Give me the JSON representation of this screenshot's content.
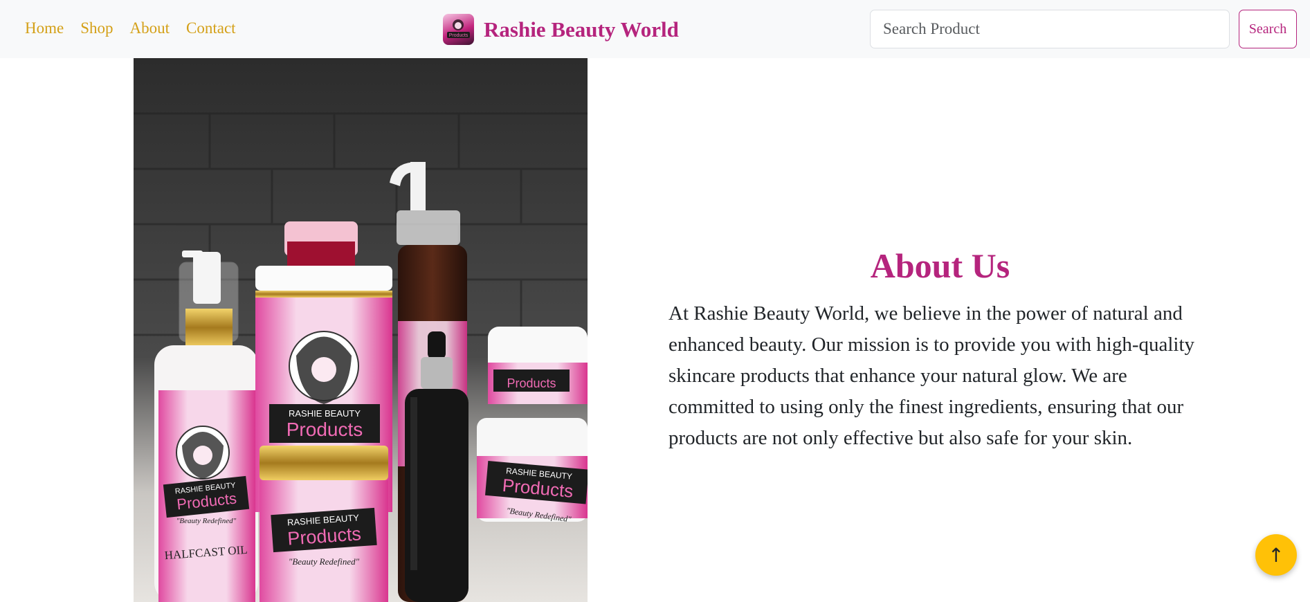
{
  "nav": {
    "links": [
      {
        "label": "Home"
      },
      {
        "label": "Shop"
      },
      {
        "label": "About"
      },
      {
        "label": "Contact"
      }
    ]
  },
  "brand": {
    "name": "Rashie Beauty World",
    "logo_text": "Products"
  },
  "search": {
    "value": "",
    "placeholder": "Search Product",
    "button_label": "Search"
  },
  "about": {
    "title": "About Us",
    "body": "At Rashie Beauty World, we believe in the power of natural and enhanced beauty. Our mission is to provide you with high-quality skincare products that enhance your natural glow. We are committed to using only the finest ingredients, ensuring that our products are not only effective but also safe for your skin."
  },
  "product_image": {
    "labels": {
      "brand_small": "RASHIE BEAUTY",
      "products": "Products",
      "tagline": "\"Beauty Redefined\"",
      "oil_name": "HALFCAST OIL"
    }
  },
  "back_to_top": {
    "icon": "arrow-up-icon",
    "glyph": "↑"
  },
  "colors": {
    "brand": "#b5247d",
    "nav_link": "#d4a017",
    "back_to_top": "#ffc107",
    "navbar_bg": "#f8f9fa"
  }
}
